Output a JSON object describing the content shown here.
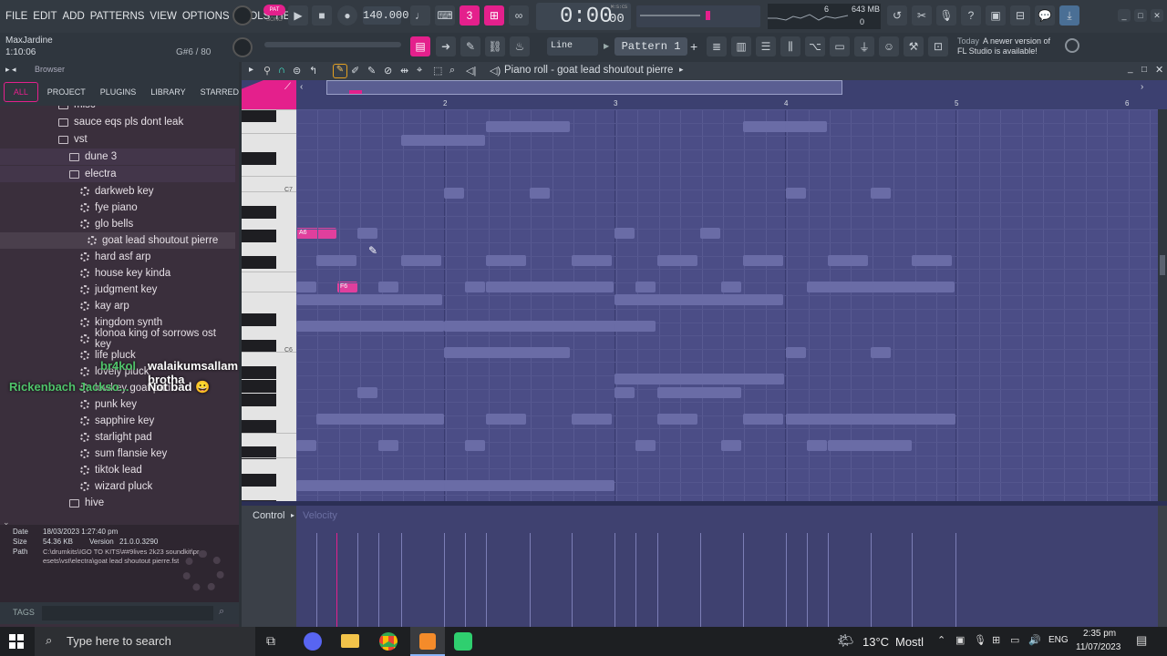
{
  "menu": [
    "FILE",
    "EDIT",
    "ADD",
    "PATTERNS",
    "VIEW",
    "OPTIONS",
    "TOOLS",
    "HELP"
  ],
  "transport": {
    "pat_label": "PAT",
    "song_label": "SONG",
    "tempo": "140.000",
    "time": "0:00",
    "time_small": "00",
    "time_unit": "M:S:CS",
    "cpu": "6",
    "mem": "643 MB",
    "poly": "0"
  },
  "project": {
    "user": "MaxJardine",
    "position": "1:10:06",
    "note_info": "G#6 / 80"
  },
  "toolbar2": {
    "snap": "Line",
    "pattern": "Pattern 1",
    "news_prefix": "Today",
    "news_text": "A newer version of",
    "news_text2": "FL Studio is available!"
  },
  "browser": {
    "title": "Browser",
    "tabs": [
      "ALL",
      "PROJECT",
      "PLUGINS",
      "LIBRARY",
      "STARRED"
    ],
    "items": [
      {
        "label": "misc",
        "type": "folder",
        "indent": 1
      },
      {
        "label": "sauce eqs pls dont leak",
        "type": "folder",
        "indent": 1
      },
      {
        "label": "vst",
        "type": "folder-open",
        "indent": 1
      },
      {
        "label": "dune 3",
        "type": "folder",
        "indent": 2
      },
      {
        "label": "electra",
        "type": "folder-open",
        "indent": 2
      },
      {
        "label": "darkweb key",
        "type": "preset",
        "indent": 3
      },
      {
        "label": "fye piano",
        "type": "preset",
        "indent": 3
      },
      {
        "label": "glo bells",
        "type": "preset",
        "indent": 3
      },
      {
        "label": "goat lead shoutout pierre",
        "type": "preset",
        "indent": 4
      },
      {
        "label": "hard asf arp",
        "type": "preset",
        "indent": 3
      },
      {
        "label": "house key kinda",
        "type": "preset",
        "indent": 3
      },
      {
        "label": "judgment key",
        "type": "preset",
        "indent": 3
      },
      {
        "label": "kay arp",
        "type": "preset",
        "indent": 3
      },
      {
        "label": "kingdom synth",
        "type": "preset",
        "indent": 3
      },
      {
        "label": "klonoa king of sorrows ost key",
        "type": "preset",
        "indent": 3
      },
      {
        "label": "life pluck",
        "type": "preset",
        "indent": 3
      },
      {
        "label": "lovely pluck",
        "type": "preset",
        "indent": 3
      },
      {
        "label": "lowkey goat pad",
        "type": "preset",
        "indent": 3
      },
      {
        "label": "punk key",
        "type": "preset",
        "indent": 3
      },
      {
        "label": "sapphire key",
        "type": "preset",
        "indent": 3
      },
      {
        "label": "starlight pad",
        "type": "preset",
        "indent": 3
      },
      {
        "label": "sum flansie key",
        "type": "preset",
        "indent": 3
      },
      {
        "label": "tiktok lead",
        "type": "preset",
        "indent": 3
      },
      {
        "label": "wizard pluck",
        "type": "preset",
        "indent": 3
      },
      {
        "label": "hive",
        "type": "folder",
        "indent": 2
      }
    ],
    "info": {
      "date_label": "Date",
      "date": "18/03/2023 1:27:40 pm",
      "size_label": "Size",
      "size": "54.36 KB",
      "version_label": "Version",
      "version": "21.0.0.3290",
      "path_label": "Path",
      "path1": "C:\\drumkits\\IGO TO KITS\\##9lives 2k23 soundkit\\pr-",
      "path2": "esets\\vst\\electra\\goat lead shoutout pierre.fst"
    },
    "tags_label": "TAGS"
  },
  "chat": [
    {
      "user": "br4kol",
      "msg": "walaikumsallam brotha",
      "color": "#4fc36a"
    },
    {
      "user": "Rickenbach Jackso...",
      "msg": "Not bad 😀",
      "color": "#4fc36a"
    }
  ],
  "piano_roll": {
    "title": "Piano roll - goat lead shoutout pierre",
    "bars": [
      "2",
      "3",
      "4",
      "5",
      "6"
    ],
    "key_labels": [
      "C7",
      "C6"
    ],
    "selected_notes": [
      {
        "label": "A6"
      },
      {
        "label": "F6"
      }
    ],
    "control_label": "Control",
    "control_target": "Velocity"
  },
  "taskbar": {
    "search": "Type here to search",
    "weather": "13°C",
    "weather2": "Mostl",
    "lang": "ENG",
    "time": "2:35 pm",
    "date": "11/07/2023"
  }
}
